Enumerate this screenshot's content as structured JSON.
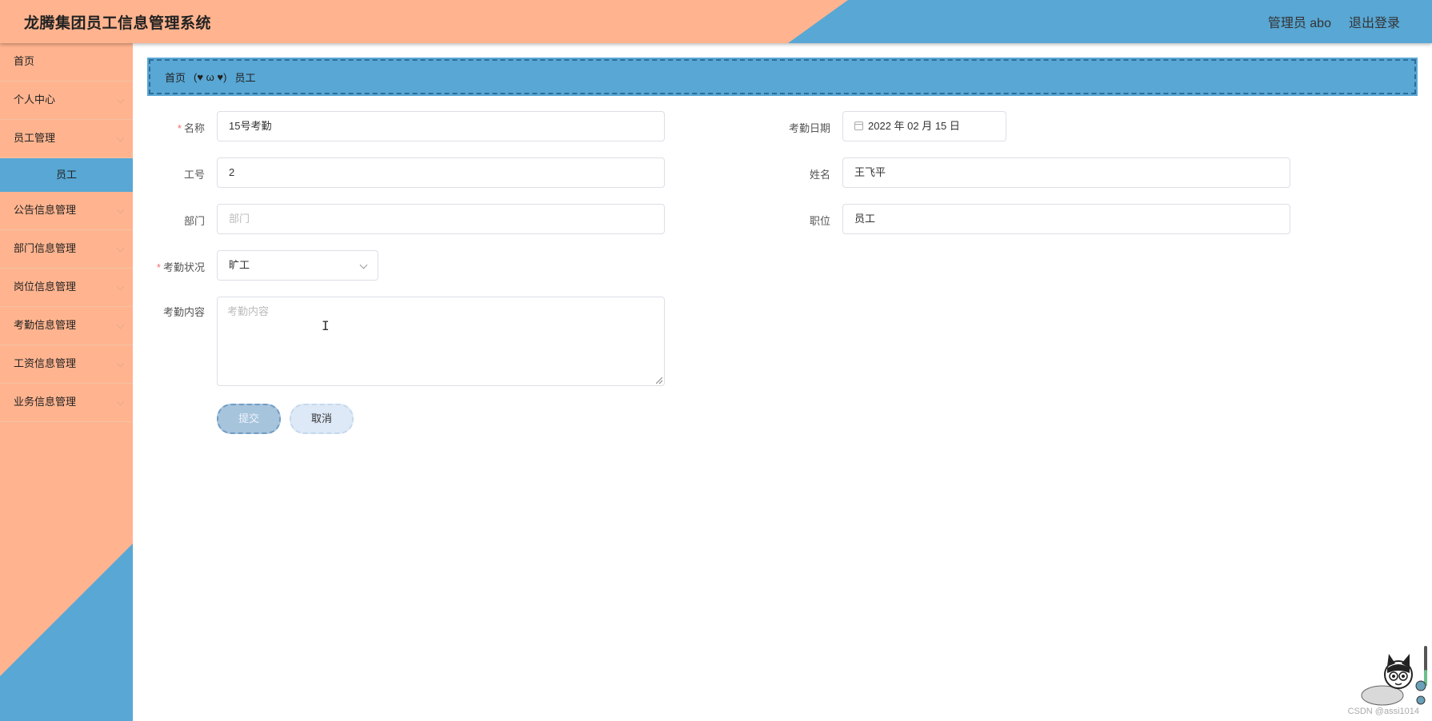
{
  "app": {
    "title": "龙腾集团员工信息管理系统",
    "user": "管理员 abo",
    "logout": "退出登录"
  },
  "sidebar": {
    "items": [
      {
        "label": "首页",
        "expandable": false
      },
      {
        "label": "个人中心",
        "expandable": true
      },
      {
        "label": "员工管理",
        "expandable": true
      },
      {
        "label": "员工",
        "expandable": false,
        "sub": true,
        "active": true
      },
      {
        "label": "公告信息管理",
        "expandable": true
      },
      {
        "label": "部门信息管理",
        "expandable": true
      },
      {
        "label": "岗位信息管理",
        "expandable": true
      },
      {
        "label": "考勤信息管理",
        "expandable": true
      },
      {
        "label": "工资信息管理",
        "expandable": true
      },
      {
        "label": "业务信息管理",
        "expandable": true
      }
    ]
  },
  "breadcrumb": {
    "home": "首页",
    "separator": "(♥ ω ♥)",
    "current": "员工"
  },
  "form": {
    "name": {
      "label": "名称",
      "value": "15号考勤",
      "required": true
    },
    "date": {
      "label": "考勤日期",
      "value": "2022 年 02 月 15 日"
    },
    "job_no": {
      "label": "工号",
      "value": "2"
    },
    "person": {
      "label": "姓名",
      "value": "王飞平"
    },
    "department": {
      "label": "部门",
      "value": "",
      "placeholder": "部门"
    },
    "position": {
      "label": "职位",
      "value": "员工"
    },
    "status": {
      "label": "考勤状况",
      "value": "旷工",
      "required": true
    },
    "content": {
      "label": "考勤内容",
      "value": "",
      "placeholder": "考勤内容"
    },
    "submit": "提交",
    "cancel": "取消"
  },
  "watermark": "CSDN @assi1014",
  "colors": {
    "peach": "#ffb48f",
    "blue": "#58a7d4",
    "required": "#f56c6c"
  },
  "icons": [
    "calendar-icon",
    "chevron-down-icon",
    "mascot-cat-icon"
  ]
}
